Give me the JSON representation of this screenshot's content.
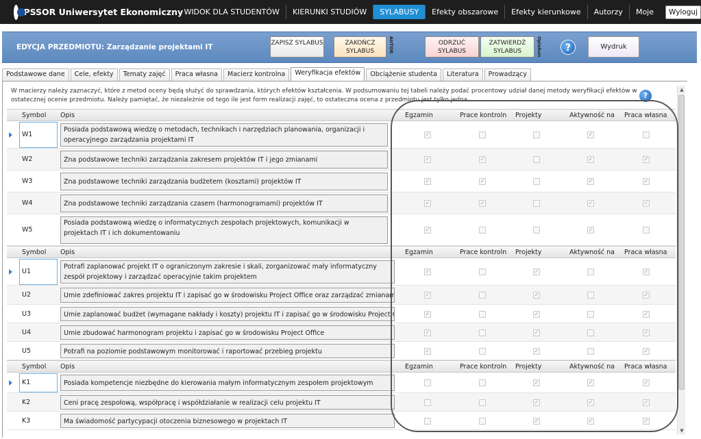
{
  "app": {
    "title": "PSSOR Uniwersytet Ekonomiczny"
  },
  "nav": [
    "WIDOK DLA STUDENTÓW",
    "KIERUNKI STUDIÓW",
    "SYLABUSY",
    "Efekty obszarowe",
    "Efekty kierunkowe",
    "Autorzy",
    "Moje"
  ],
  "nav_active": "SYLABUSY",
  "logout_label": "Wyloguj",
  "band": {
    "title": "EDYCJA PRZEDMIOTU: Zarządzanie projektami IT",
    "save": "ZAPISZ SYLABUS",
    "finish": "ZAKOŃCZ SYLABUS",
    "autor": "AUTOR",
    "reject": "ODRZUĆ SYLABUS",
    "approve": "ZATWIERDŹ SYLABUS",
    "opiekun": "Opiekun",
    "help": "?",
    "print": "Wydruk"
  },
  "tabs": [
    "Podstawowe dane",
    "Cele, efekty",
    "Tematy zajęć",
    "Praca własna",
    "Macierz kontrolna",
    "Weryfikacja efektów",
    "Obciążenie studenta",
    "Literatura",
    "Prowadzący"
  ],
  "active_tab": "Weryfikacja efektów",
  "instructions": "W macierzy należy zaznaczyć, które z metod oceny będą służyć do sprawdzania, których efektów kształcenia. W podsumowaniu tej tabeli należy podać procentowy udział danej metody weryfikacji efektów w ostatecznej ocenie przedmiotu. Należy pamiętać, że niezależnie od tego ile jest form realizacji zajęć, to ostateczna ocena z przedmiotu jest tylko jedna.",
  "columns": {
    "symbol": "Symbol",
    "opis": "Opis",
    "methods": [
      "Egzamin",
      "Prace kontroln",
      "Projekty",
      "Aktywność na",
      "Praca własna"
    ]
  },
  "groups": [
    {
      "rows": [
        {
          "symbol": "W1",
          "desc": "Posiada podstawową wiedzę o metodach, technikach i narzędziach planowania, organizacji i operacyjnego zarządzania projektami IT",
          "checks": [
            true,
            false,
            false,
            true,
            false
          ]
        },
        {
          "symbol": "W2",
          "desc": "Zna podstawowe techniki zarządzania zakresem projektów IT i jego zmianami",
          "checks": [
            true,
            true,
            false,
            true,
            true
          ]
        },
        {
          "symbol": "W3",
          "desc": "Zna podstawowe techniki zarządzania budżetem (kosztami) projektów IT",
          "checks": [
            true,
            true,
            false,
            true,
            true
          ]
        },
        {
          "symbol": "W4",
          "desc": "Zna podstawowe techniki zarządzania czasem (harmonogramami) projektów IT",
          "checks": [
            true,
            true,
            false,
            true,
            true
          ]
        },
        {
          "symbol": "W5",
          "desc": "Posiada podstawową wiedzę o informatycznych zespołach projektowych, komunikacji w projektach IT i ich dokumentowaniu",
          "checks": [
            true,
            false,
            false,
            true,
            false
          ]
        }
      ]
    },
    {
      "rows": [
        {
          "symbol": "U1",
          "desc": "Potrafi zaplanować projekt IT o ograniczonym zakresie i skali, zorganizować mały informatyczny zespół projektowy i zarządzać operacyjnie takim projektem",
          "checks": [
            true,
            false,
            true,
            false,
            true
          ]
        },
        {
          "symbol": "U2",
          "desc": "Umie zdefiniować zakres projektu IT i zapisać go w środowisku Project Office oraz zarządzać zmianami zakresu",
          "checks": [
            true,
            false,
            true,
            false,
            true
          ]
        },
        {
          "symbol": "U3",
          "desc": "Umie zaplanować budżet (wymagane nakłady i koszty) projektu IT i zapisać go w środowisku Project Office",
          "checks": [
            true,
            false,
            true,
            false,
            true
          ]
        },
        {
          "symbol": "U4",
          "desc": "Umie zbudować harmonogram projektu i zapisać go w środowisku Project Office",
          "checks": [
            true,
            false,
            true,
            false,
            true
          ]
        },
        {
          "symbol": "U5",
          "desc": "Potrafi na poziomie podstawowym monitorować i raportować przebieg projektu",
          "checks": [
            true,
            false,
            true,
            false,
            true
          ]
        }
      ]
    },
    {
      "rows": [
        {
          "symbol": "K1",
          "desc": "Posiada kompetencje niezbędne do kierowania małym informatycznym zespołem projektowym",
          "checks": [
            false,
            false,
            true,
            true,
            true
          ]
        },
        {
          "symbol": "K2",
          "desc": "Ceni pracę zespołową, współpracę i współdziałanie w realizacji celu projektu IT",
          "checks": [
            false,
            false,
            true,
            true,
            true
          ]
        },
        {
          "symbol": "K3",
          "desc": "Ma świadomość partycypacji otoczenia biznesowego w projektach IT",
          "checks": [
            false,
            false,
            true,
            true,
            true
          ]
        }
      ]
    }
  ]
}
